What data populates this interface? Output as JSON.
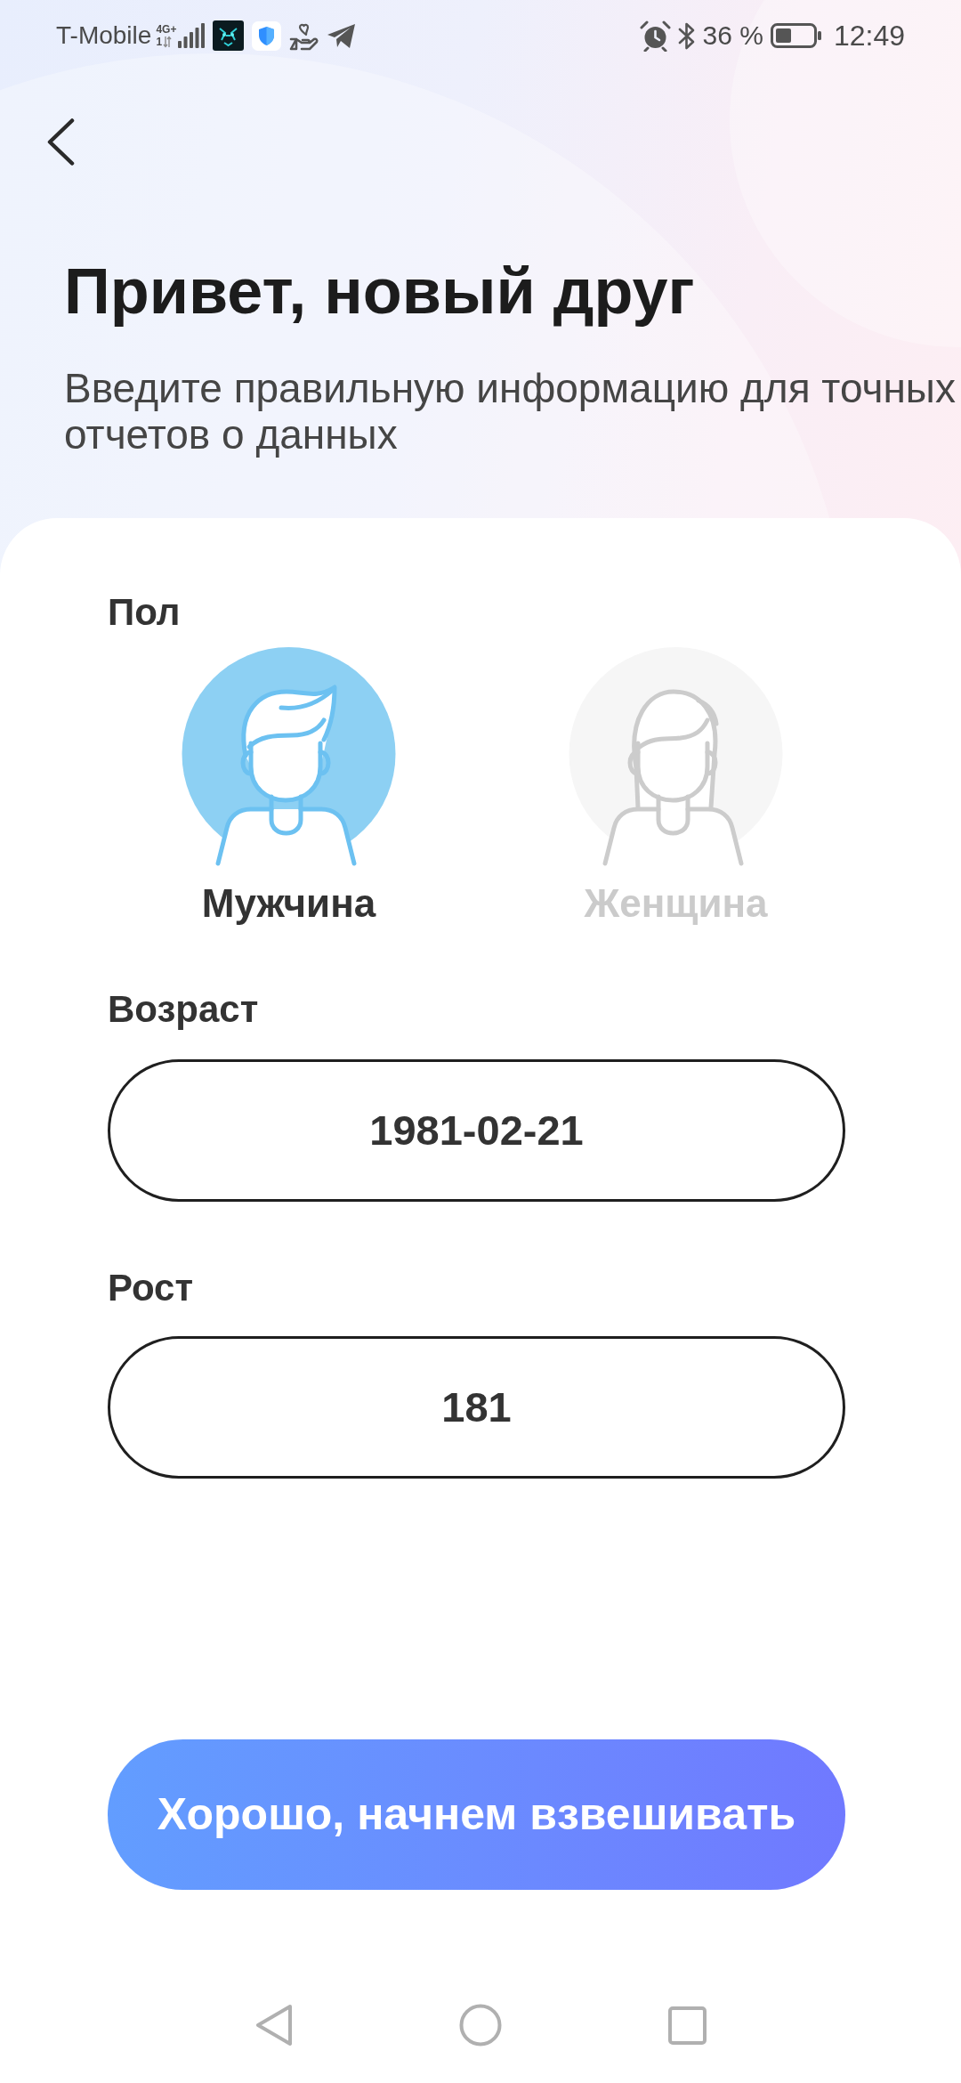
{
  "status_bar": {
    "carrier": "T-Mobile",
    "network": "4G+",
    "sim": "1",
    "battery": "36 %",
    "time": "12:49"
  },
  "header": {
    "title": "Привет, новый друг",
    "subtitle": "Введите правильную информацию для точных отчетов о данных"
  },
  "gender": {
    "label": "Пол",
    "options": [
      {
        "kind": "male",
        "label": "Мужчина",
        "selected": true
      },
      {
        "kind": "female",
        "label": "Женщина",
        "selected": false
      }
    ]
  },
  "fields": [
    {
      "label": "Возраст",
      "value": "1981-02-21"
    },
    {
      "label": "Рост",
      "value": "181"
    }
  ],
  "submit_button": {
    "label": "Хорошо, начнем взвешивать"
  }
}
